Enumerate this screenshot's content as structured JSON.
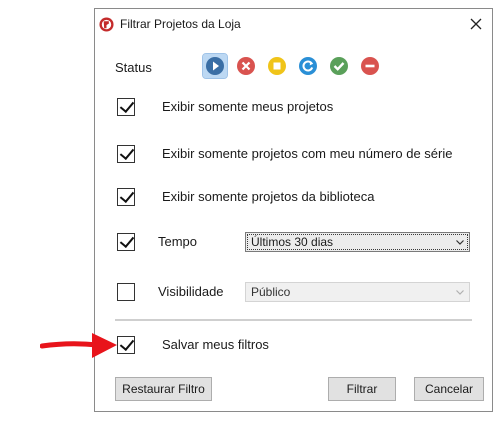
{
  "dialog": {
    "title": "Filtrar Projetos da Loja",
    "app_icon": "app-logo-icon",
    "close_icon": "close-icon"
  },
  "status": {
    "label": "Status",
    "icons": [
      {
        "name": "play-icon",
        "color": "#3a6ea5",
        "selected": true
      },
      {
        "name": "cancel-icon",
        "color": "#d9534f",
        "selected": false
      },
      {
        "name": "stop-icon",
        "color": "#f0c419",
        "selected": false
      },
      {
        "name": "refresh-icon",
        "color": "#2a8fd6",
        "selected": false
      },
      {
        "name": "check-icon",
        "color": "#5aa05a",
        "selected": false
      },
      {
        "name": "block-icon",
        "color": "#d9534f",
        "selected": false
      }
    ]
  },
  "filters": {
    "my_projects": {
      "label": "Exibir somente meus projetos",
      "checked": true
    },
    "my_serial": {
      "label": "Exibir somente projetos com meu número de série",
      "checked": true
    },
    "library": {
      "label": "Exibir somente projetos da biblioteca",
      "checked": true
    },
    "time": {
      "label": "Tempo",
      "checked": true,
      "value": "Últimos 30 dias"
    },
    "visibility": {
      "label": "Visibilidade",
      "checked": false,
      "value": "Público"
    },
    "save": {
      "label": "Salvar meus filtros",
      "checked": true
    }
  },
  "buttons": {
    "reset": "Restaurar Filtro",
    "filter": "Filtrar",
    "cancel": "Cancelar"
  },
  "colors": {
    "annotation_arrow": "#e8141b",
    "selected_highlight": "#bcd8f3"
  }
}
